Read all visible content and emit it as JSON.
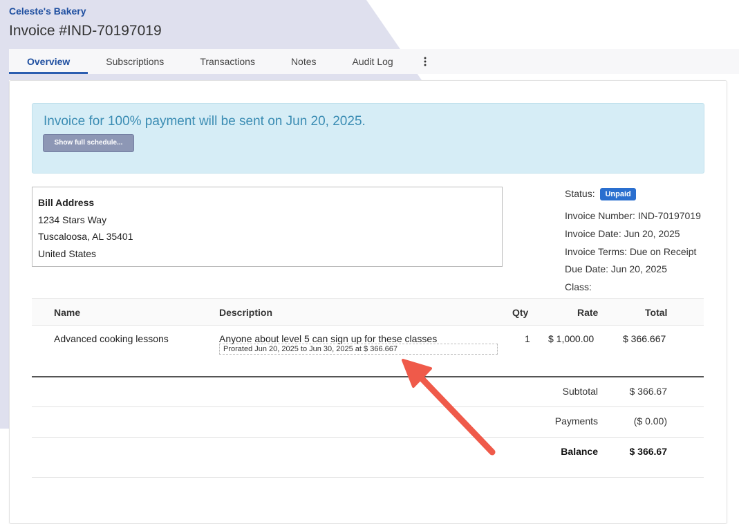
{
  "header": {
    "company": "Celeste's Bakery",
    "title": "Invoice #IND-70197019"
  },
  "tabs": [
    {
      "label": "Overview",
      "active": true
    },
    {
      "label": "Subscriptions"
    },
    {
      "label": "Transactions"
    },
    {
      "label": "Notes"
    },
    {
      "label": "Audit Log"
    }
  ],
  "banner": {
    "text": "Invoice for 100% payment will be sent on Jun 20, 2025.",
    "button_label": "Show full schedule..."
  },
  "bill_address": {
    "title": "Bill Address",
    "line1": "1234 Stars Way",
    "line2": "Tuscaloosa, AL 35401",
    "line3": "United States"
  },
  "meta": {
    "status_label": "Status:",
    "status_value": "Unpaid",
    "invoice_number": "Invoice Number: IND-70197019",
    "invoice_date": "Invoice Date: Jun 20, 2025",
    "invoice_terms": "Invoice Terms: Due on Receipt",
    "due_date": "Due Date: Jun 20, 2025",
    "class": "Class:"
  },
  "table": {
    "headers": {
      "name": "Name",
      "description": "Description",
      "qty": "Qty",
      "rate": "Rate",
      "total": "Total"
    },
    "rows": [
      {
        "name": "Advanced cooking lessons",
        "description": "Anyone about level 5 can sign up for these classes",
        "proration": "Prorated Jun 20, 2025 to Jun 30, 2025 at $ 366.667",
        "qty": "1",
        "rate": "$ 1,000.00",
        "total": "$ 366.667"
      }
    ]
  },
  "summary": {
    "subtotal_label": "Subtotal",
    "subtotal_value": "$ 366.67",
    "payments_label": "Payments",
    "payments_value": "($ 0.00)",
    "balance_label": "Balance",
    "balance_value": "$ 366.67"
  },
  "colors": {
    "accent": "#1f4fa0",
    "banner_bg": "#d6edf6",
    "badge": "#2a6fcf",
    "arrow": "#ef5a4a"
  },
  "icons": {
    "tab_more": "vertical-ellipsis-icon",
    "annotation": "red-arrow-icon"
  }
}
